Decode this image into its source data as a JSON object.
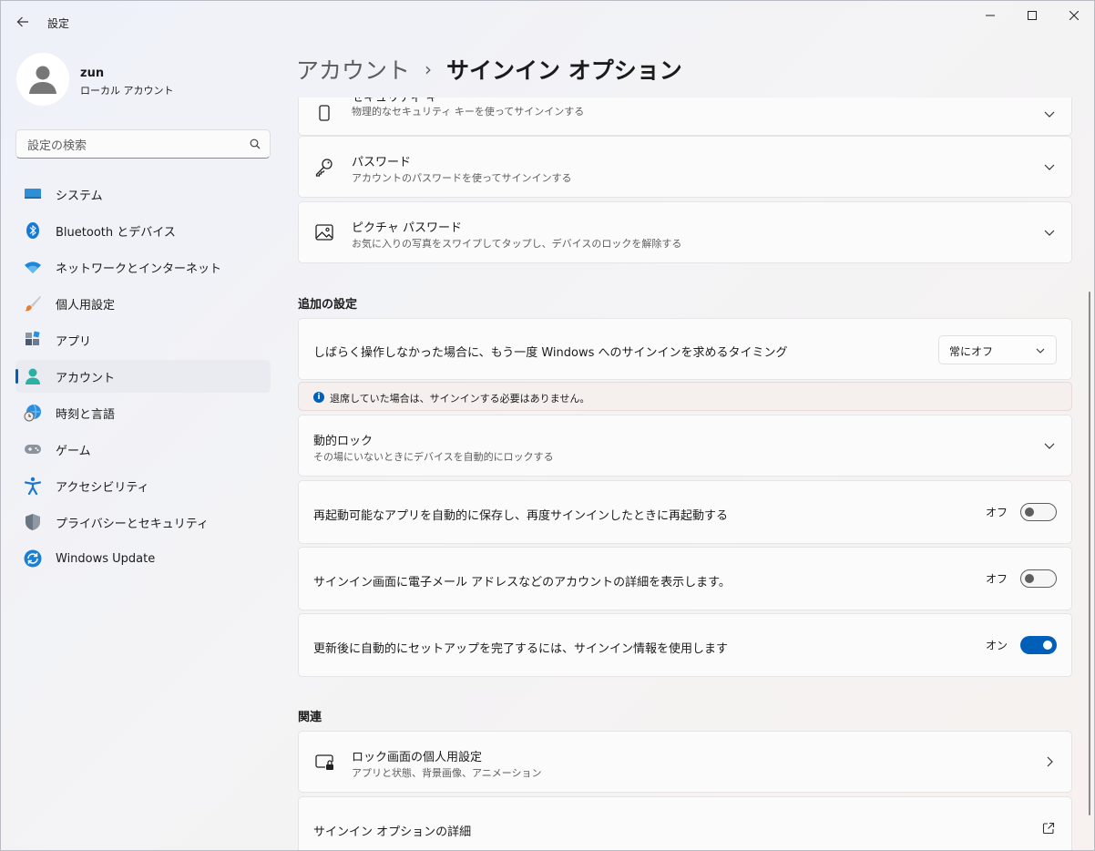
{
  "window": {
    "title": "設定",
    "back_icon": "arrow-left-icon",
    "controls": [
      "minimize-icon",
      "maximize-icon",
      "close-icon"
    ]
  },
  "profile": {
    "name": "zun",
    "account_type": "ローカル アカウント"
  },
  "search": {
    "placeholder": "設定の検索",
    "value": ""
  },
  "sidebar": {
    "items": [
      {
        "label": "システム",
        "icon": "system-icon",
        "active": false
      },
      {
        "label": "Bluetooth とデバイス",
        "icon": "bluetooth-icon",
        "active": false
      },
      {
        "label": "ネットワークとインターネット",
        "icon": "wifi-icon",
        "active": false
      },
      {
        "label": "個人用設定",
        "icon": "brush-icon",
        "active": false
      },
      {
        "label": "アプリ",
        "icon": "apps-icon",
        "active": false
      },
      {
        "label": "アカウント",
        "icon": "account-icon",
        "active": true
      },
      {
        "label": "時刻と言語",
        "icon": "time-language-icon",
        "active": false
      },
      {
        "label": "ゲーム",
        "icon": "gamepad-icon",
        "active": false
      },
      {
        "label": "アクセシビリティ",
        "icon": "accessibility-icon",
        "active": false
      },
      {
        "label": "プライバシーとセキュリティ",
        "icon": "shield-icon",
        "active": false
      },
      {
        "label": "Windows Update",
        "icon": "windows-update-icon",
        "active": false
      }
    ]
  },
  "breadcrumb": {
    "parent": "アカウント",
    "separator": "›",
    "current": "サインイン オプション"
  },
  "cards": {
    "security_key": {
      "title": "セキュリティ キー",
      "subtitle": "物理的なセキュリティ キーを使ってサインインする"
    },
    "password": {
      "title": "パスワード",
      "subtitle": "アカウントのパスワードを使ってサインインする"
    },
    "picture_password": {
      "title": "ピクチャ パスワード",
      "subtitle": "お気に入りの写真をスワイプしてタップし、デバイスのロックを解除する"
    }
  },
  "additional": {
    "heading": "追加の設定",
    "require_signin": {
      "label": "しばらく操作しなかった場合に、もう一度 Windows へのサインインを求めるタイミング",
      "dropdown_value": "常にオフ"
    },
    "info": "退席していた場合は、サインインする必要はありません。",
    "dynamic_lock": {
      "title": "動的ロック",
      "subtitle": "その場にいないときにデバイスを自動的にロックする"
    },
    "restart_apps": {
      "label": "再起動可能なアプリを自動的に保存し、再度サインインしたときに再起動する",
      "state": "オフ",
      "on": false
    },
    "show_details": {
      "label": "サインイン画面に電子メール アドレスなどのアカウントの詳細を表示します。",
      "state": "オフ",
      "on": false
    },
    "auto_setup": {
      "label": "更新後に自動的にセットアップを完了するには、サインイン情報を使用します",
      "state": "オン",
      "on": true
    }
  },
  "related": {
    "heading": "関連",
    "lock_screen": {
      "title": "ロック画面の個人用設定",
      "subtitle": "アプリと状態、背景画像、アニメーション"
    },
    "more_options": {
      "title": "サインイン オプションの詳細"
    }
  },
  "colors": {
    "accent": "#005fb8",
    "card": "#fbfbfb",
    "info_bar": "#f5efee"
  }
}
